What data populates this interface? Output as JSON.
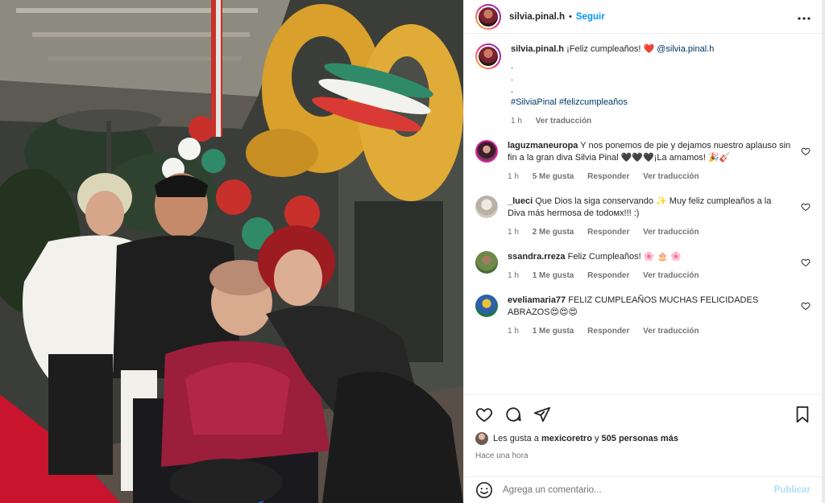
{
  "post": {
    "username": "silvia.pinal.h",
    "follow_label": "Seguir",
    "separator": "•",
    "more_label": "•••"
  },
  "caption": {
    "username": "silvia.pinal.h",
    "text": "¡Feliz cumpleaños!",
    "heart": "❤️",
    "mention": "@silvia.pinal.h",
    "dots": [
      ".",
      ".",
      "."
    ],
    "hashtags": "#SilviaPinal #felizcumpleaños",
    "time": "1 h",
    "translate": "Ver traducción"
  },
  "comments": [
    {
      "username": "laguzmaneuropa",
      "text": "Y nos ponemos de pie y dejamos nuestro aplauso sin fin a la gran diva Silvia Pinal 🖤🖤🖤¡La amamos! 🎉🎸",
      "time": "1 h",
      "likes": "5 Me gusta",
      "reply": "Responder",
      "translate": "Ver traducción",
      "avatar_color": "#7a3a5a"
    },
    {
      "username": "_lueci",
      "text": "Que Dios la siga conservando ✨ Muy feliz cumpleaños a la Diva más hermosa de todoмх!!! :)",
      "time": "1 h",
      "likes": "2 Me gusta",
      "reply": "Responder",
      "translate": "Ver traducción",
      "avatar_color": "#cfc9c0"
    },
    {
      "username": "ssandra.rreza",
      "text": "Feliz Cumpleaños! 🌸 🎂 🌸",
      "time": "1 h",
      "likes": "1 Me gusta",
      "reply": "Responder",
      "translate": "Ver traducción",
      "avatar_color": "#6b8a4a"
    },
    {
      "username": "eveliamaria77",
      "text": "FELIZ CUMPLEAÑOS MUCHAS FELICIDADES ABRAZOS😍😍😍",
      "time": "1 h",
      "likes": "1 Me gusta",
      "reply": "Responder",
      "translate": "Ver traducción",
      "avatar_color": "#2e5fa8"
    }
  ],
  "likes_line": {
    "prefix": "Les gusta a",
    "user": "mexicoretro",
    "middle": "y",
    "count": "505 personas más"
  },
  "posted": "Hace una hora",
  "composer": {
    "placeholder": "Agrega un comentario...",
    "publish_label": "Publicar"
  },
  "icons": [
    "heart-icon",
    "comment-icon",
    "share-icon",
    "bookmark-icon",
    "emoji-icon",
    "more-icon"
  ],
  "colors": {
    "link": "#00376b",
    "follow": "#0095f6",
    "meta": "#737373",
    "publish_disabled": "#b2dffc"
  }
}
